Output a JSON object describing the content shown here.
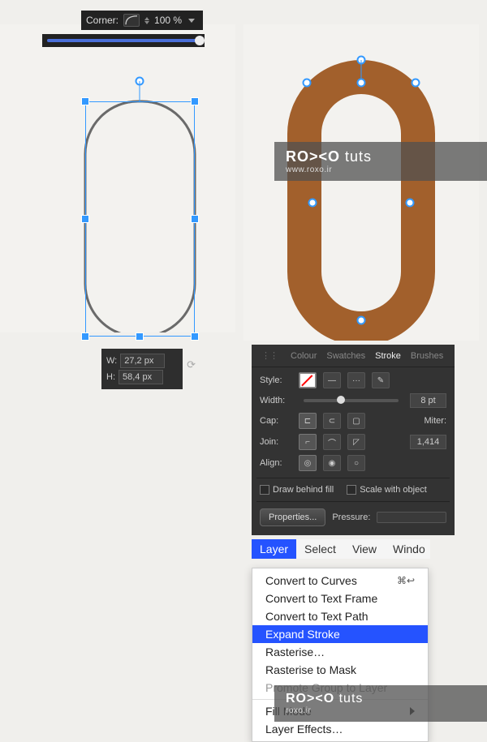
{
  "corner": {
    "label": "Corner:",
    "percent": "100 %"
  },
  "wh": {
    "w_label": "W:",
    "w_val": "27,2 px",
    "h_label": "H:",
    "h_val": "58,4 px"
  },
  "watermark": {
    "brand": "RO><O",
    "sub": "tuts",
    "url": "www.roxo.ir",
    "url2": "roxo.ir"
  },
  "stroke_panel": {
    "tabs": [
      "Colour",
      "Swatches",
      "Stroke",
      "Brushes"
    ],
    "active_tab": 2,
    "style_label": "Style:",
    "width_label": "Width:",
    "width_val": "8 pt",
    "cap_label": "Cap:",
    "join_label": "Join:",
    "align_label": "Align:",
    "miter_label": "Miter:",
    "miter_val": "1,414",
    "draw_behind": "Draw behind fill",
    "scale_with": "Scale with object",
    "properties_btn": "Properties...",
    "pressure_label": "Pressure:"
  },
  "menubar": {
    "items": [
      "Layer",
      "Select",
      "View",
      "Windo"
    ],
    "selected": 0
  },
  "dropdown": {
    "items": [
      {
        "label": "Convert to Curves",
        "shortcut": "⌘↩"
      },
      {
        "label": "Convert to Text Frame"
      },
      {
        "label": "Convert to Text Path"
      },
      {
        "label": "Expand Stroke",
        "selected": true
      },
      {
        "label": "Rasterise…"
      },
      {
        "label": "Rasterise to Mask"
      },
      {
        "label": "Promote Group to Layer",
        "disabled": true
      },
      {
        "sep": true
      },
      {
        "label": "Fill Mode",
        "submenu": true
      },
      {
        "label": "Layer Effects…"
      }
    ]
  },
  "shapes": {
    "stroke_color": "#a2602c",
    "outline_color": "#5a5a5a"
  }
}
